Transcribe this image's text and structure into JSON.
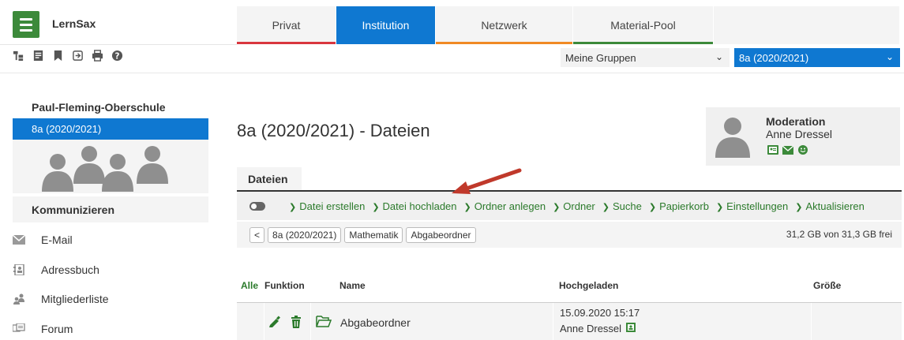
{
  "app": {
    "brand": "LernSax"
  },
  "tabs": [
    {
      "label": "Privat",
      "accent": "#d9363e",
      "active": false
    },
    {
      "label": "Institution",
      "accent": "#0f78d1",
      "active": true
    },
    {
      "label": "Netzwerk",
      "accent": "#f08a24",
      "active": false
    },
    {
      "label": "Material-Pool",
      "accent": "#3c8a3a",
      "active": false
    }
  ],
  "toolbar": {
    "icons": [
      "sitemap-icon",
      "notes-icon",
      "bookmark-icon",
      "login-icon",
      "print-icon",
      "help-icon"
    ]
  },
  "selectors": {
    "groups": "Meine Gruppen",
    "class": "8a (2020/2021)"
  },
  "sidebar": {
    "school": "Paul-Fleming-Oberschule",
    "selected_class": "8a (2020/2021)",
    "section_heading": "Kommunizieren",
    "items": [
      {
        "label": "E-Mail",
        "icon": "envelope-icon"
      },
      {
        "label": "Adressbuch",
        "icon": "addressbook-icon"
      },
      {
        "label": "Mitgliederliste",
        "icon": "members-icon"
      },
      {
        "label": "Forum",
        "icon": "forum-icon"
      }
    ]
  },
  "main": {
    "title": "8a (2020/2021) - Dateien",
    "moderation": {
      "title": "Moderation",
      "name": "Anne Dressel"
    },
    "tab": "Dateien",
    "actions": [
      "Datei erstellen",
      "Datei hochladen",
      "Ordner anlegen",
      "Ordner",
      "Suche",
      "Papierkorb",
      "Einstellungen",
      "Aktualisieren"
    ],
    "breadcrumb": {
      "back": "<",
      "items": [
        "8a (2020/2021)",
        "Mathematik",
        "Abgabeordner"
      ]
    },
    "storage": "31,2 GB von 31,3 GB frei",
    "table": {
      "headers": {
        "all": "Alle",
        "function": "Funktion",
        "name": "Name",
        "uploaded": "Hochgeladen",
        "size": "Größe"
      },
      "rows": [
        {
          "name": "Abgabeordner",
          "uploaded_date": "15.09.2020 15:17",
          "uploaded_by": "Anne Dressel",
          "size": ""
        }
      ]
    }
  },
  "colors": {
    "primary_blue": "#0f78d1",
    "brand_green": "#3c8a3a",
    "link_green": "#2b7a2b",
    "annotation_arrow": "#c0392b"
  }
}
